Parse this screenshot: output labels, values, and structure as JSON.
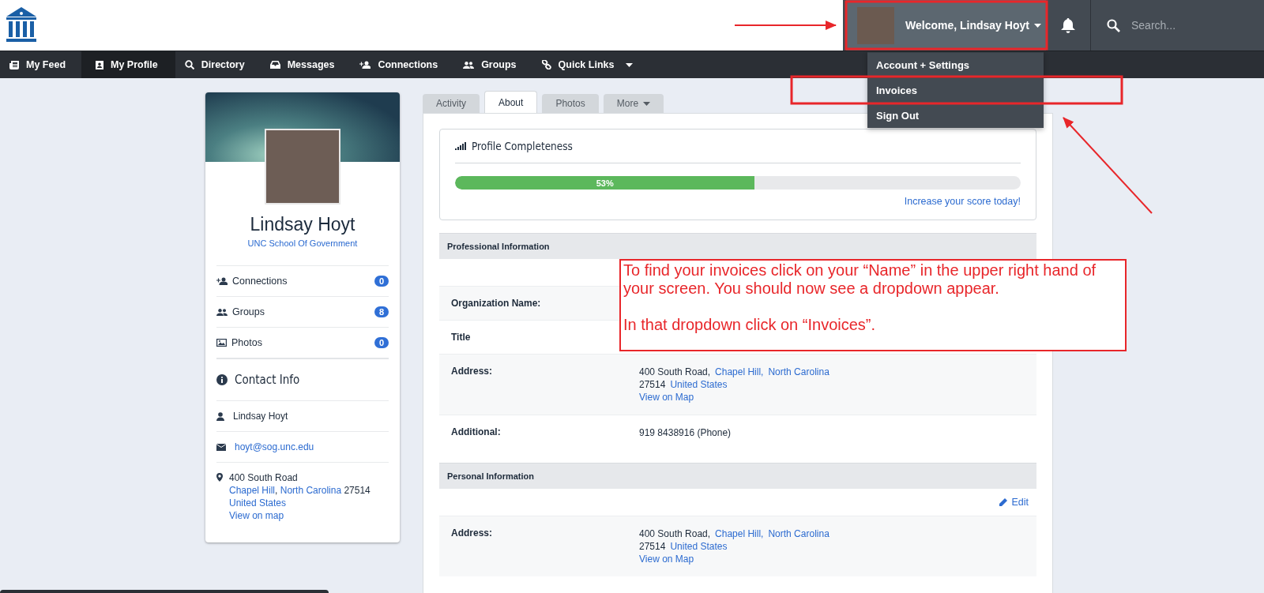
{
  "header": {
    "user": {
      "greeting": "Welcome, Lindsay Hoyt"
    },
    "search": {
      "placeholder": "Search..."
    }
  },
  "nav": {
    "items": [
      {
        "label": "My Feed",
        "selected": false
      },
      {
        "label": "My Profile",
        "selected": true
      },
      {
        "label": "Directory",
        "selected": false
      },
      {
        "label": "Messages",
        "selected": false
      },
      {
        "label": "Connections",
        "selected": false
      },
      {
        "label": "Groups",
        "selected": false
      },
      {
        "label": "Quick Links",
        "selected": false
      }
    ]
  },
  "user_menu": {
    "items": [
      {
        "label": "Account + Settings"
      },
      {
        "label": "Invoices"
      },
      {
        "label": "Sign Out"
      }
    ]
  },
  "profile_card": {
    "name": "Lindsay Hoyt",
    "organization": "UNC School Of Government",
    "stats": [
      {
        "label": "Connections",
        "count": "0"
      },
      {
        "label": "Groups",
        "count": "8"
      },
      {
        "label": "Photos",
        "count": "0"
      }
    ],
    "contact_title": "Contact Info",
    "contact_name": "Lindsay Hoyt",
    "email": "hoyt@sog.unc.edu",
    "address": [
      [
        {
          "text": "400 South Road",
          "link": false
        }
      ],
      [
        {
          "text": "Chapel Hill",
          "link": true
        },
        {
          "text": ",",
          "link": false
        },
        {
          "text": " North Carolina",
          "link": true
        },
        {
          "text": " 27514",
          "link": false
        }
      ],
      [
        {
          "text": "United States",
          "link": true
        }
      ],
      [
        {
          "text": "View on map",
          "link": true
        }
      ]
    ]
  },
  "tabs": [
    {
      "label": "Activity",
      "selected": false,
      "dropdown": false
    },
    {
      "label": "About",
      "selected": true,
      "dropdown": false
    },
    {
      "label": "Photos",
      "selected": false,
      "dropdown": false
    },
    {
      "label": "More",
      "selected": false,
      "dropdown": true
    }
  ],
  "completeness": {
    "title": "Profile Completeness",
    "level": 0.53,
    "reading": "53%",
    "link": "Increase your score today!"
  },
  "sections": [
    {
      "title": "Professional Information",
      "rows": [
        {
          "label": "Organization Name:"
        },
        {
          "label": "Title"
        },
        {
          "label": "Address:",
          "value": [
            [
              {
                "text": "400 South Road,",
                "link": false
              },
              {
                "text": "Chapel Hill,",
                "link": true
              },
              {
                "text": "North Carolina",
                "link": true
              }
            ],
            [
              {
                "text": "27514",
                "link": false
              },
              {
                "text": "United States",
                "link": true
              }
            ],
            [
              {
                "text": "View on Map",
                "link": true
              }
            ]
          ]
        },
        {
          "label": "Additional:",
          "value": [
            [
              {
                "text": "919 8438916 (Phone)",
                "link": false
              }
            ]
          ]
        }
      ]
    },
    {
      "title": "Personal Information",
      "action": "Edit",
      "rows": [
        {
          "label": "Address:",
          "value": [
            [
              {
                "text": "400 South Road,",
                "link": false
              },
              {
                "text": "Chapel Hill,",
                "link": true
              },
              {
                "text": "North Carolina",
                "link": true
              }
            ],
            [
              {
                "text": "27514",
                "link": false
              },
              {
                "text": "United States",
                "link": true
              }
            ],
            [
              {
                "text": "View on Map",
                "link": true
              }
            ]
          ]
        }
      ]
    }
  ],
  "annotation": {
    "callout": [
      "To find your invoices click on your “Name” in the upper right hand of your screen. You should now see a dropdown appear.",
      "In that dropdown click on “Invoices”."
    ]
  }
}
